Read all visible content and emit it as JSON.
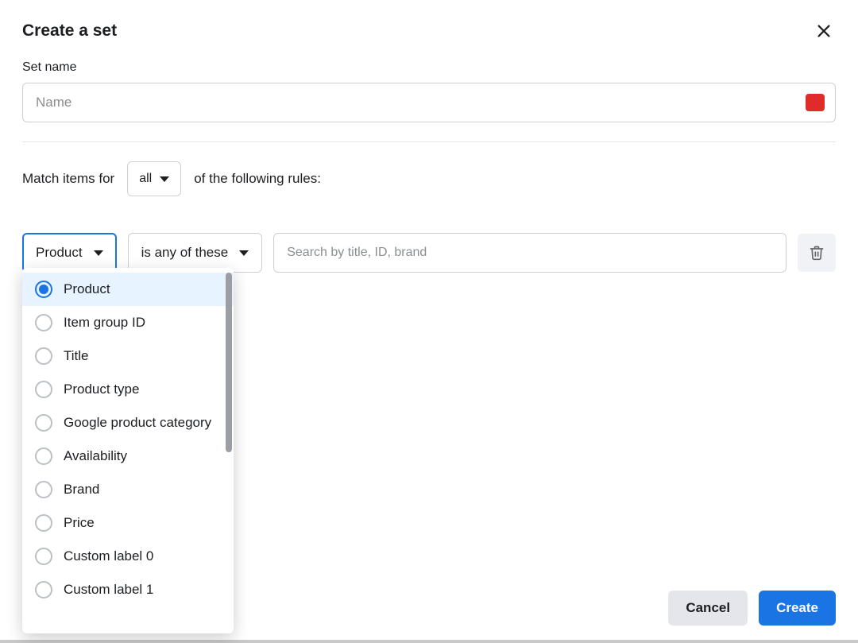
{
  "modal": {
    "title": "Create a set",
    "close_icon": "close"
  },
  "set_name": {
    "label": "Set name",
    "placeholder": "Name",
    "value": ""
  },
  "match_rule": {
    "prefix": "Match items for",
    "scope_value": "all",
    "suffix": "of the following rules:"
  },
  "rule": {
    "field_value": "Product",
    "operator_value": "is any of these",
    "search_placeholder": "Search by title, ID, brand",
    "search_value": ""
  },
  "field_dropdown": {
    "selected_index": 0,
    "options": [
      "Product",
      "Item group ID",
      "Title",
      "Product type",
      "Google product category",
      "Availability",
      "Brand",
      "Price",
      "Custom label 0",
      "Custom label 1"
    ]
  },
  "footer": {
    "cancel": "Cancel",
    "create": "Create"
  },
  "colors": {
    "accent": "#1b74e4",
    "danger_badge": "#e02b2b",
    "selected_bg": "#e7f3ff"
  }
}
